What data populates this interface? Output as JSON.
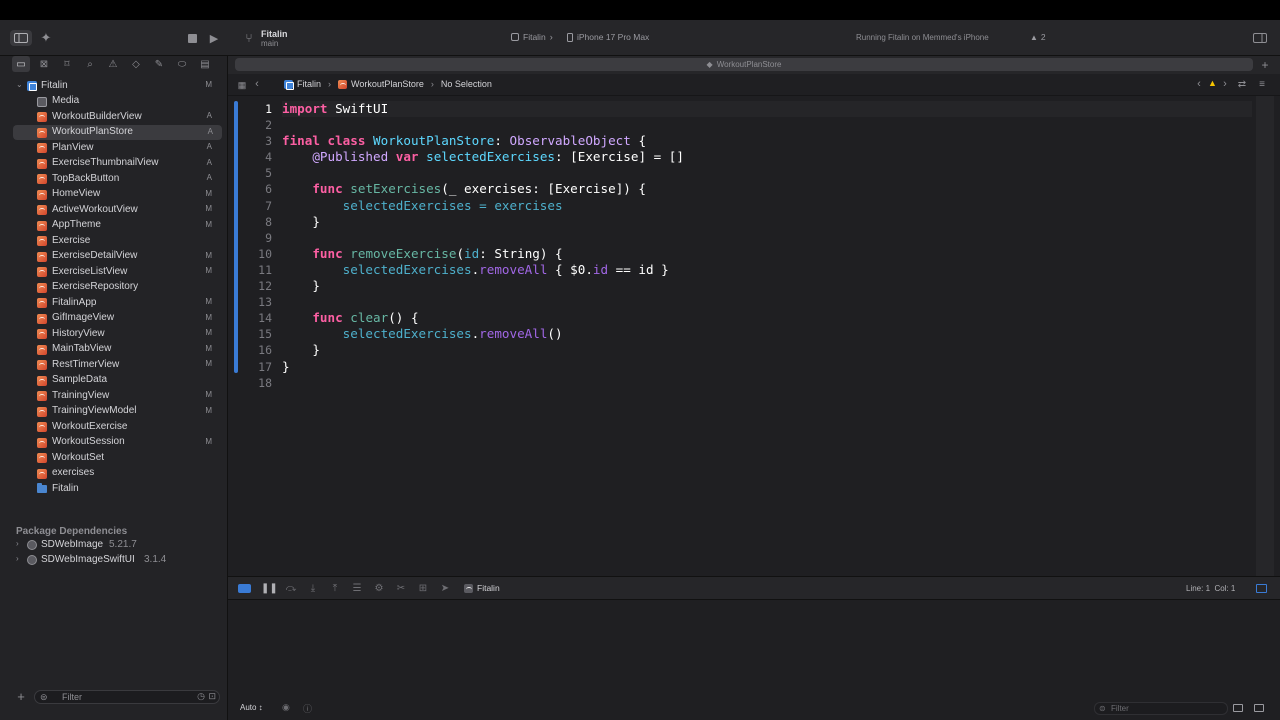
{
  "toolbar": {
    "project_name": "Fitalin",
    "branch": "main",
    "scheme": "Fitalin",
    "scheme_chevron": "›",
    "device": "iPhone 17 Pro Max",
    "status": "Running Fitalin on Memmed's iPhone",
    "warning_count": "2"
  },
  "sidebar": {
    "root": {
      "label": "Fitalin",
      "badge": "M"
    },
    "items": [
      {
        "label": "Media",
        "badge": "",
        "icon": "asset-catalog-icon"
      },
      {
        "label": "WorkoutBuilderView",
        "badge": "A",
        "icon": "swift-file-icon"
      },
      {
        "label": "WorkoutPlanStore",
        "badge": "A",
        "icon": "swift-file-icon",
        "selected": true
      },
      {
        "label": "PlanView",
        "badge": "A",
        "icon": "swift-file-icon"
      },
      {
        "label": "ExerciseThumbnailView",
        "badge": "A",
        "icon": "swift-file-icon"
      },
      {
        "label": "TopBackButton",
        "badge": "A",
        "icon": "swift-file-icon"
      },
      {
        "label": "HomeView",
        "badge": "M",
        "icon": "swift-file-icon"
      },
      {
        "label": "ActiveWorkoutView",
        "badge": "M",
        "icon": "swift-file-icon"
      },
      {
        "label": "AppTheme",
        "badge": "M",
        "icon": "swift-file-icon"
      },
      {
        "label": "Exercise",
        "badge": "",
        "icon": "swift-file-icon"
      },
      {
        "label": "ExerciseDetailView",
        "badge": "M",
        "icon": "swift-file-icon"
      },
      {
        "label": "ExerciseListView",
        "badge": "M",
        "icon": "swift-file-icon"
      },
      {
        "label": "ExerciseRepository",
        "badge": "",
        "icon": "swift-file-icon"
      },
      {
        "label": "FitalinApp",
        "badge": "M",
        "icon": "swift-file-icon"
      },
      {
        "label": "GifImageView",
        "badge": "M",
        "icon": "swift-file-icon"
      },
      {
        "label": "HistoryView",
        "badge": "M",
        "icon": "swift-file-icon"
      },
      {
        "label": "MainTabView",
        "badge": "M",
        "icon": "swift-file-icon"
      },
      {
        "label": "RestTimerView",
        "badge": "M",
        "icon": "swift-file-icon"
      },
      {
        "label": "SampleData",
        "badge": "",
        "icon": "swift-file-icon"
      },
      {
        "label": "TrainingView",
        "badge": "M",
        "icon": "swift-file-icon"
      },
      {
        "label": "TrainingViewModel",
        "badge": "M",
        "icon": "swift-file-icon"
      },
      {
        "label": "WorkoutExercise",
        "badge": "",
        "icon": "swift-file-icon"
      },
      {
        "label": "WorkoutSession",
        "badge": "M",
        "icon": "swift-file-icon"
      },
      {
        "label": "WorkoutSet",
        "badge": "",
        "icon": "swift-file-icon"
      },
      {
        "label": "exercises",
        "badge": "",
        "icon": "swift-file-icon"
      },
      {
        "label": "Fitalin",
        "badge": "",
        "icon": "folder-icon"
      }
    ],
    "package_section": "Package Dependencies",
    "packages": [
      {
        "name": "SDWebImage",
        "version": "5.21.7"
      },
      {
        "name": "SDWebImageSwiftUI",
        "version": "3.1.4"
      }
    ],
    "filter_placeholder": "Filter"
  },
  "editor": {
    "tab_title": "WorkoutPlanStore",
    "breadcrumb": [
      "Fitalin",
      "WorkoutPlanStore",
      "No Selection"
    ],
    "line_numbers": [
      "1",
      "2",
      "3",
      "4",
      "5",
      "6",
      "7",
      "8",
      "9",
      "10",
      "11",
      "12",
      "13",
      "14",
      "15",
      "16",
      "17",
      "18"
    ],
    "code": {
      "l1_kw": "import",
      "l1_rest": " SwiftUI",
      "l3_kw1": "final",
      "l3_kw2": "class",
      "l3_name": "WorkoutPlanStore",
      "l3_colon": ": ",
      "l3_proto": "ObservableObject",
      "l3_brace": " {",
      "l4_attr": "@Published",
      "l4_kw": "var",
      "l4_name": "selectedExercises",
      "l4_rest1": ": [",
      "l4_type": "Exercise",
      "l4_rest2": "] = []",
      "l6_kw": "func",
      "l6_name": "setExercises",
      "l6_rest1": "(_ exercises: [",
      "l6_type": "Exercise",
      "l6_rest2": "]) {",
      "l7_text": "selectedExercises = exercises",
      "brace_close": "}",
      "l10_kw": "func",
      "l10_name": "removeExercise",
      "l10_rest1": "(",
      "l10_param": "id",
      "l10_rest2": ": ",
      "l10_type": "String",
      "l10_rest3": ") {",
      "l11_var": "selectedExercises",
      "l11_dot": ".",
      "l11_call": "removeAll",
      "l11_rest1": " { $0.",
      "l11_prop": "id",
      "l11_rest2": " == id }",
      "l14_kw": "func",
      "l14_name": "clear",
      "l14_rest": "() {",
      "l15_var": "selectedExercises",
      "l15_dot": ".",
      "l15_call": "removeAll",
      "l15_rest": "()"
    }
  },
  "debug_bar": {
    "target": "Fitalin",
    "cursor_position": "Line: 1  Col: 1"
  },
  "bottom": {
    "auto_label": "Auto ↕",
    "filter_placeholder": "Filter"
  },
  "colors": {
    "accent": "#3a7bd5",
    "keyword": "#fc5fa3",
    "type": "#5dd8ff",
    "function": "#67b7a4",
    "status_green": "#33c75a",
    "warning": "#f5c400"
  }
}
